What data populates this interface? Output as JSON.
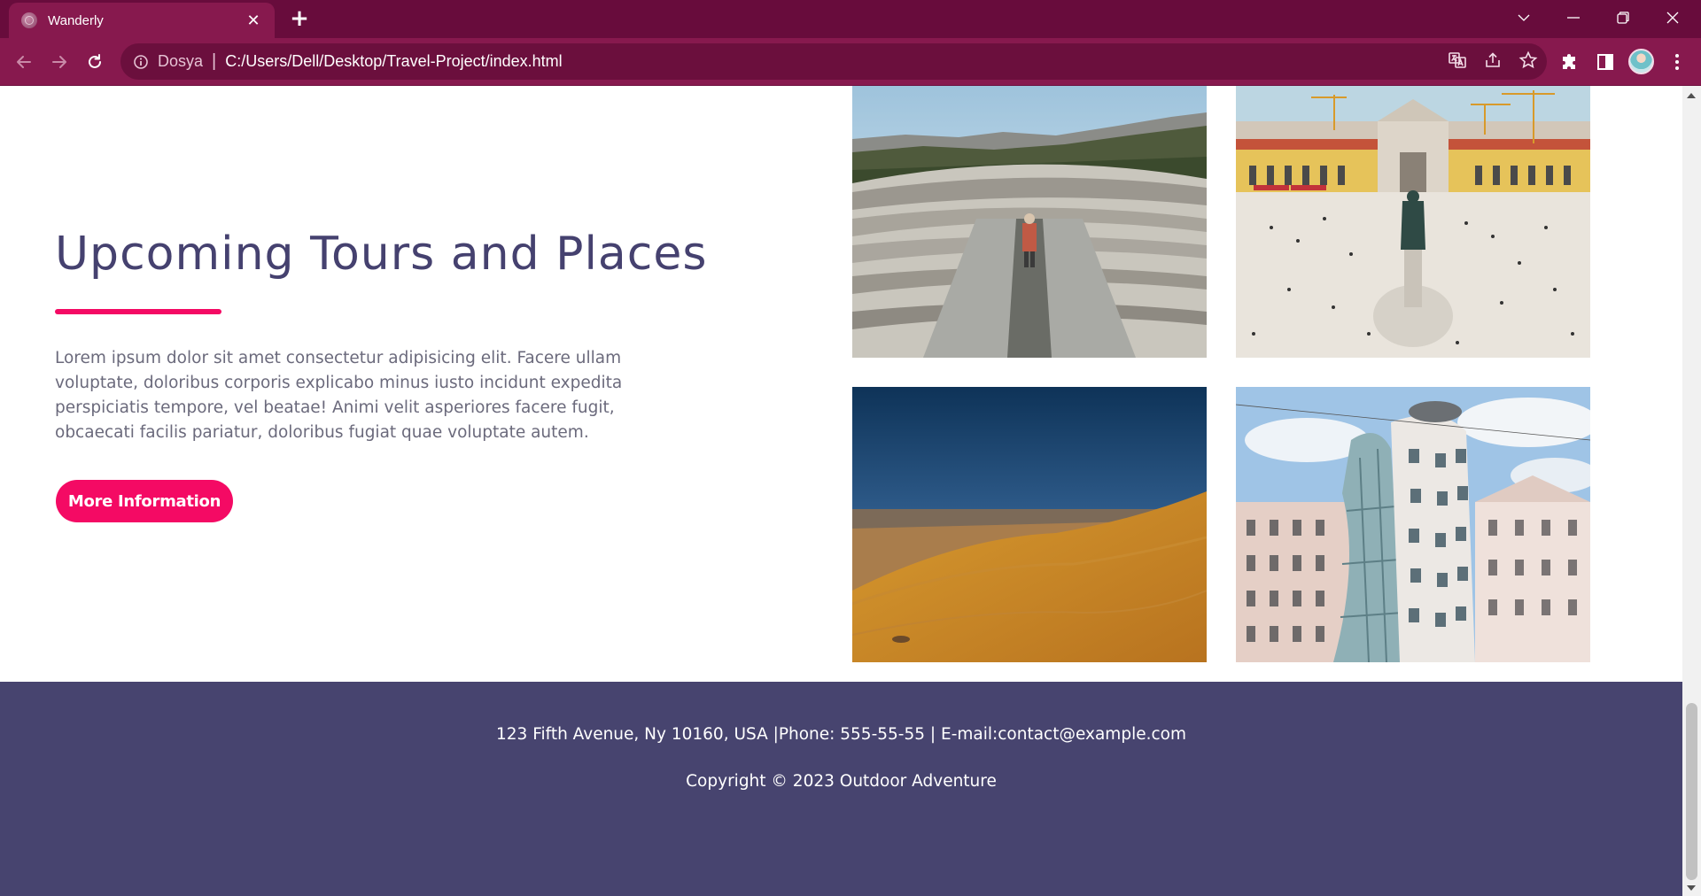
{
  "browser": {
    "tab_title": "Wanderly",
    "tab_close_glyph": "✕",
    "new_tab_glyph": "+",
    "url_scheme_label": "Dosya",
    "url_separator": "|",
    "url_path": "C:/Users/Dell/Desktop/Travel-Project/index.html"
  },
  "section": {
    "heading": "Upcoming Tours and Places",
    "description": "Lorem ipsum dolor sit amet consectetur adipisicing elit. Facere ullam voluptate, doloribus corporis explicabo minus iusto incidunt expedita perspiciatis tempore, vel beatae! Animi velit asperiores facere fugit, obcaecati facilis pariatur, doloribus fugiat quae voluptate autem.",
    "button_label": "More Information",
    "accent_color": "#f40a64",
    "heading_color": "#45416f"
  },
  "gallery": {
    "images": [
      "ancient-amphitheater",
      "city-square-with-statue",
      "desert-dunes",
      "dancing-house-building"
    ]
  },
  "footer": {
    "contact": "123 Fifth Avenue, Ny 10160, USA |Phone: 555-55-55 | E-mail:contact@example.com",
    "copyright": "Copyright © 2023 Outdoor Adventure",
    "background_color": "#47446f"
  },
  "theme": {
    "browser_frame_color": "#680c3c",
    "toolbar_color": "#87194e"
  }
}
